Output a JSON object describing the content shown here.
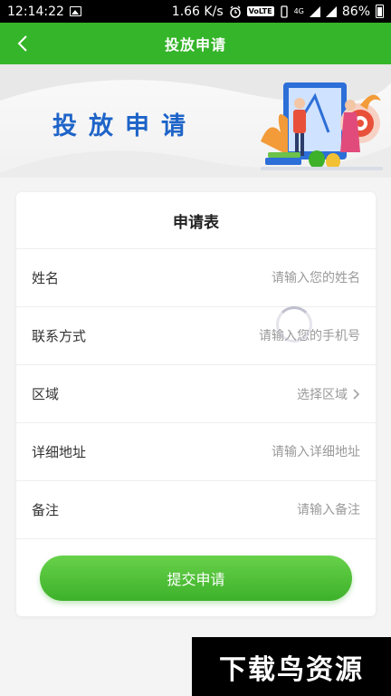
{
  "status_bar": {
    "time": "12:14:22",
    "speed": "1.66 K/s",
    "volte": "VoLTE",
    "network": "4G",
    "battery": "86%"
  },
  "navbar": {
    "title": "投放申请",
    "back_icon": "chevron-left-icon"
  },
  "banner": {
    "title": "投放申请"
  },
  "form": {
    "title": "申请表",
    "fields": [
      {
        "label": "姓名",
        "placeholder": "请输入您的姓名"
      },
      {
        "label": "联系方式",
        "placeholder": "请输入您的手机号"
      },
      {
        "label": "区域",
        "placeholder": "选择区域"
      },
      {
        "label": "详细地址",
        "placeholder": "请输入详细地址"
      },
      {
        "label": "备注",
        "placeholder": "请输入备注"
      }
    ],
    "submit_label": "提交申请"
  },
  "watermark": {
    "text": "下载鸟资源"
  },
  "colors": {
    "primary_green": "#35b529",
    "banner_blue": "#1e64c8"
  }
}
